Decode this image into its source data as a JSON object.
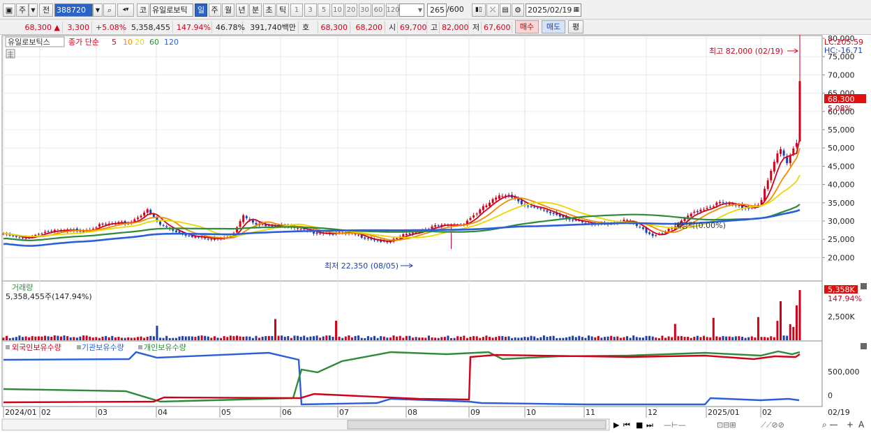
{
  "toolbar": {
    "market_button": "주",
    "prev_button": "전",
    "code": "388720",
    "type_button": "코",
    "stock_name": "유일로보틱",
    "periods": [
      "일",
      "주",
      "월",
      "년",
      "분",
      "초",
      "틱"
    ],
    "active_period": "일",
    "intervals": [
      "1",
      "3",
      "5",
      "10",
      "20",
      "30",
      "60",
      "120"
    ],
    "count": "265",
    "count_total": "/600",
    "date": "2025/02/19"
  },
  "quote": {
    "price": "68,300",
    "arrow": "▲",
    "change": "3,300",
    "change_pct": "+5.08%",
    "volume": "5,358,455",
    "volume_pct": "147.94%",
    "turnover_pct": "46.78%",
    "amount": "391,740백만",
    "ask_label": "호가",
    "ask": "68,300",
    "bid": "68,200",
    "open_label": "시",
    "open": "69,700",
    "high_label": "고",
    "high": "82,000",
    "low_label": "저",
    "low": "67,600",
    "buy_button": "매수",
    "sell_button": "매도",
    "avg_button": "평"
  },
  "price_panel": {
    "legend_name": "유일로보틱스",
    "legend_ma": "종가 단순",
    "ma_periods": [
      {
        "label": "5",
        "color": "#d0021b"
      },
      {
        "label": "10",
        "color": "#f08c00"
      },
      {
        "label": "20",
        "color": "#e8d800"
      },
      {
        "label": "60",
        "color": "#2e8b3a"
      },
      {
        "label": "120",
        "color": "#2b5fd9"
      }
    ],
    "lc": "LC:205.59",
    "hc": "HC:-16.71",
    "high_note": "최고 82,000 (02/19)",
    "low_note": "최저 22,350 (08/05)",
    "dividend_note": "배당락(0.00%)",
    "current_price_tag": "68,300",
    "current_pct_tag": "5.08%",
    "y_ticks": [
      "80,000",
      "75,000",
      "70,000",
      "65,000",
      "60,000",
      "55,000",
      "50,000",
      "45,000",
      "40,000",
      "35,000",
      "30,000",
      "25,000",
      "20,000"
    ]
  },
  "volume_panel": {
    "title": "거래량",
    "value": "5,358,455주(147.94%)",
    "tag": "5,358K",
    "tag_pct": "147.94%",
    "y_tick": "2,500K"
  },
  "holdings_panel": {
    "foreign": "외국인보유수량",
    "institution": "기관보유수량",
    "individual": "개인보유수량",
    "y_ticks": [
      "500,000",
      "0"
    ]
  },
  "x_axis": {
    "labels": [
      "2024/01",
      "02",
      "03",
      "04",
      "05",
      "06",
      "07",
      "08",
      "09",
      "10",
      "11",
      "12",
      "2025/01",
      "02"
    ],
    "right_label": "02/19"
  },
  "colors": {
    "up": "#d0021b",
    "down": "#1f3fae",
    "ma5": "#d0021b",
    "ma10": "#f08c00",
    "ma20": "#e8d800",
    "ma60": "#2e8b3a",
    "ma120": "#2b5fd9",
    "foreign": "#2b5fd9",
    "institution": "#d0021b",
    "individual": "#2e8b3a"
  }
}
